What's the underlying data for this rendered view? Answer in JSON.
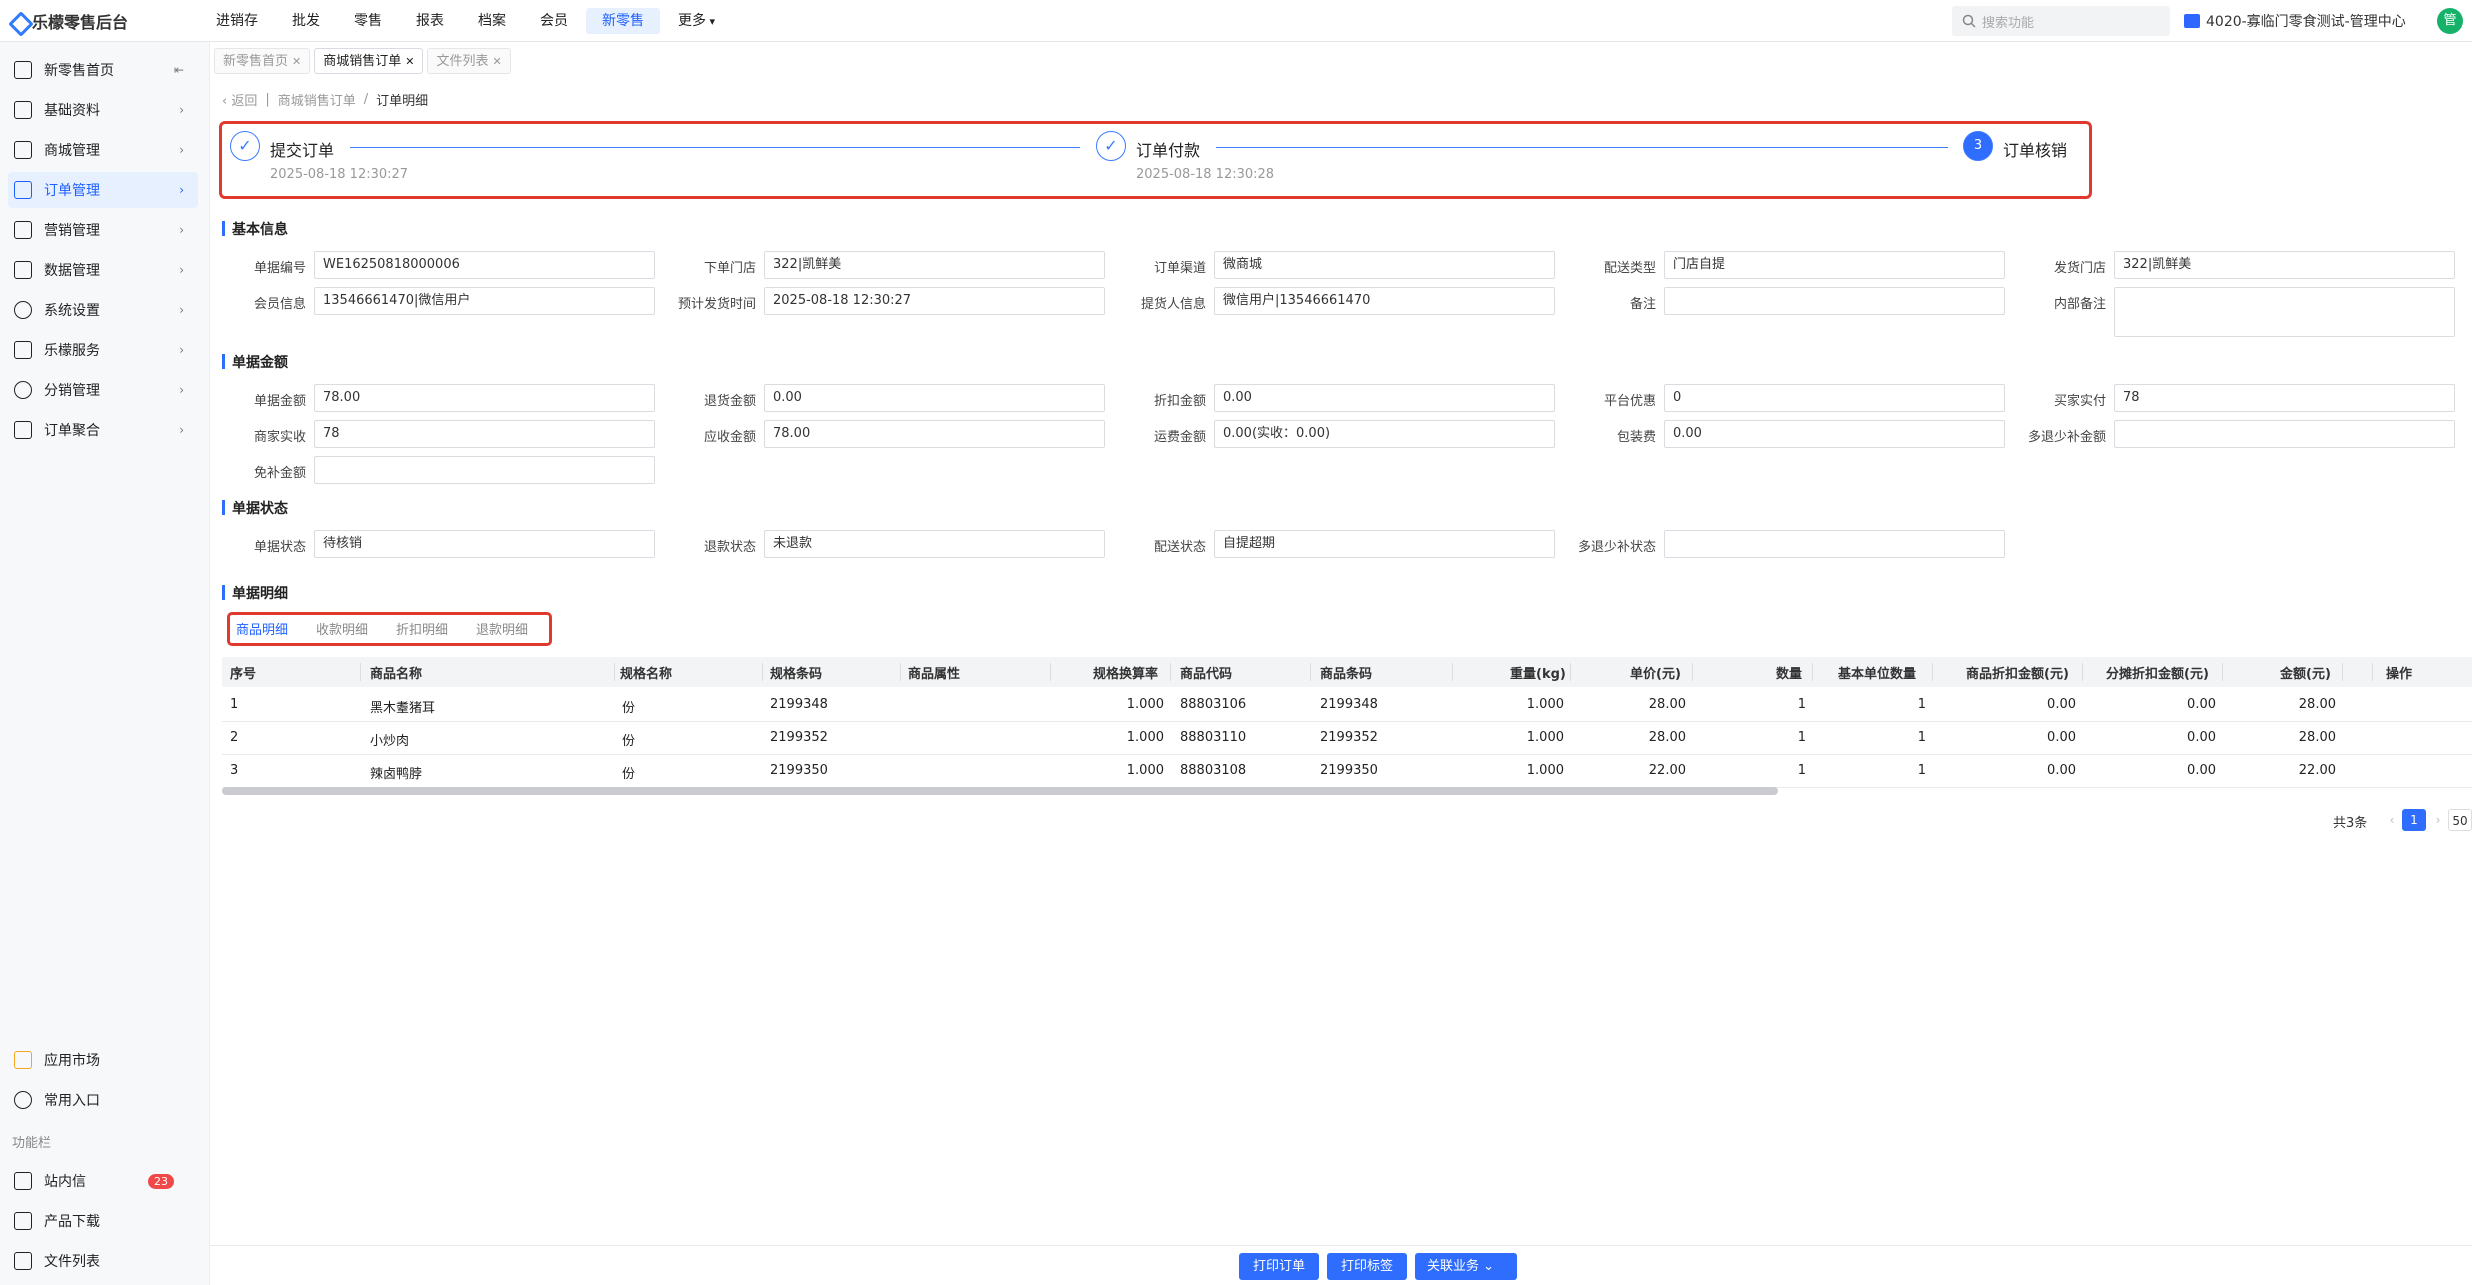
{
  "app": {
    "title": "乐檬零售后台"
  },
  "topnav": [
    "进销存",
    "批发",
    "零售",
    "报表",
    "档案",
    "会员",
    "新零售",
    "更多"
  ],
  "search": {
    "placeholder": "搜索功能"
  },
  "org": {
    "name": "4020-寡临门零食测试-管理中心"
  },
  "user": {
    "avatar_text": "管"
  },
  "sidebar": {
    "items": [
      {
        "label": "新零售首页"
      },
      {
        "label": "基础资料"
      },
      {
        "label": "商城管理"
      },
      {
        "label": "订单管理"
      },
      {
        "label": "营销管理"
      },
      {
        "label": "数据管理"
      },
      {
        "label": "系统设置"
      },
      {
        "label": "乐檬服务"
      },
      {
        "label": "分销管理"
      },
      {
        "label": "订单聚合"
      }
    ],
    "bottom": [
      {
        "label": "应用市场"
      },
      {
        "label": "常用入口"
      }
    ],
    "section_label": "功能栏",
    "func": [
      {
        "label": "站内信",
        "badge": "23"
      },
      {
        "label": "产品下载"
      },
      {
        "label": "文件列表"
      }
    ]
  },
  "tabs": [
    {
      "label": "新零售首页"
    },
    {
      "label": "商城销售订单"
    },
    {
      "label": "文件列表"
    }
  ],
  "breadcrumb": {
    "back": "返回",
    "parent": "商城销售订单",
    "sep": "/",
    "current": "订单明细"
  },
  "steps": [
    {
      "title": "提交订单",
      "time": "2025-08-18 12:30:27",
      "done": true
    },
    {
      "title": "订单付款",
      "time": "2025-08-18 12:30:28",
      "done": true
    },
    {
      "title": "订单核销",
      "num": "3",
      "done": false
    }
  ],
  "basic": {
    "title": "基本信息",
    "rows": [
      [
        {
          "label": "单据编号",
          "value": "WE16250818000006"
        },
        {
          "label": "下单门店",
          "value": "322|凯鲜美"
        },
        {
          "label": "订单渠道",
          "value": "微商城"
        },
        {
          "label": "配送类型",
          "value": "门店自提"
        },
        {
          "label": "发货门店",
          "value": "322|凯鲜美"
        }
      ],
      [
        {
          "label": "会员信息",
          "value": "13546661470|微信用户"
        },
        {
          "label": "预计发货时间",
          "value": "2025-08-18 12:30:27"
        },
        {
          "label": "提货人信息",
          "value": "微信用户|13546661470"
        },
        {
          "label": "备注",
          "value": ""
        },
        {
          "label": "内部备注",
          "value": ""
        }
      ]
    ]
  },
  "amount": {
    "title": "单据金额",
    "rows": [
      [
        {
          "label": "单据金额",
          "value": "78.00"
        },
        {
          "label": "退货金额",
          "value": "0.00"
        },
        {
          "label": "折扣金额",
          "value": "0.00"
        },
        {
          "label": "平台优惠",
          "value": "0"
        },
        {
          "label": "买家实付",
          "value": "78"
        }
      ],
      [
        {
          "label": "商家实收",
          "value": "78"
        },
        {
          "label": "应收金额",
          "value": "78.00"
        },
        {
          "label": "运费金额",
          "value": "0.00(实收：0.00)"
        },
        {
          "label": "包装费",
          "value": "0.00"
        },
        {
          "label": "多退少补金额",
          "value": ""
        }
      ],
      [
        {
          "label": "免补金额",
          "value": ""
        }
      ]
    ]
  },
  "status": {
    "title": "单据状态",
    "fields": [
      {
        "label": "单据状态",
        "value": "待核销"
      },
      {
        "label": "退款状态",
        "value": "未退款"
      },
      {
        "label": "配送状态",
        "value": "自提超期"
      },
      {
        "label": "多退少补状态",
        "value": ""
      }
    ]
  },
  "detail": {
    "title": "单据明细",
    "subtabs": [
      "商品明细",
      "收款明细",
      "折扣明细",
      "退款明细"
    ],
    "columns": [
      "序号",
      "商品名称",
      "规格名称",
      "规格条码",
      "商品属性",
      "规格换算率",
      "商品代码",
      "商品条码",
      "重量(kg)",
      "单价(元)",
      "数量",
      "基本单位数量",
      "商品折扣金额(元)",
      "分摊折扣金额(元)",
      "金额(元)",
      "操作"
    ],
    "rows": [
      [
        "1",
        "黑木耋猪耳",
        "份",
        "2199348",
        "",
        "1.000",
        "88803106",
        "2199348",
        "1.000",
        "28.00",
        "1",
        "1",
        "0.00",
        "0.00",
        "28.00",
        ""
      ],
      [
        "2",
        "小炒肉",
        "份",
        "2199352",
        "",
        "1.000",
        "88803110",
        "2199352",
        "1.000",
        "28.00",
        "1",
        "1",
        "0.00",
        "0.00",
        "28.00",
        ""
      ],
      [
        "3",
        "辣卤鸭脖",
        "份",
        "2199350",
        "",
        "1.000",
        "88803108",
        "2199350",
        "1.000",
        "22.00",
        "1",
        "1",
        "0.00",
        "0.00",
        "22.00",
        ""
      ]
    ]
  },
  "pager": {
    "total": "共3条",
    "prev": "‹",
    "page": "1",
    "next": "›",
    "size": "50"
  },
  "footer": {
    "print_order": "打印订单",
    "print_label": "打印标签",
    "related": "关联业务"
  },
  "colors": {
    "accent": "#2f6dff",
    "highlight": "#e03a2f",
    "badge": "#f04848"
  }
}
